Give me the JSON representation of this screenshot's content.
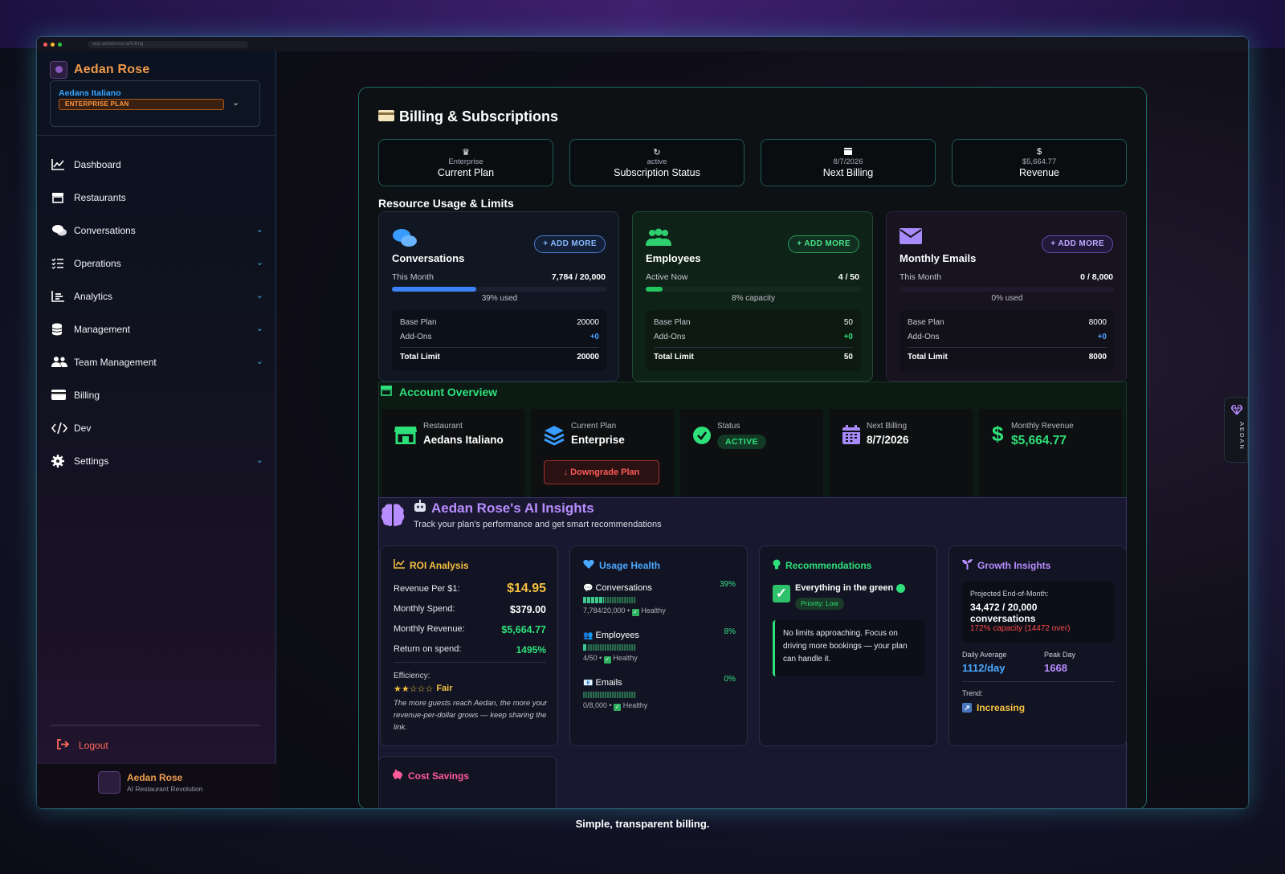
{
  "browser": {
    "url": "app.aedanrose.ai/billing"
  },
  "brand": {
    "name": "Aedan Rose",
    "tagline": "AI Restaurant Revolution"
  },
  "account": {
    "name": "Aedans Italiano",
    "plan_badge": "ENTERPRISE PLAN"
  },
  "sidebar": {
    "items": [
      {
        "label": "Dashboard",
        "icon": "chart-line-icon",
        "expandable": false
      },
      {
        "label": "Restaurants",
        "icon": "store-icon",
        "expandable": false
      },
      {
        "label": "Conversations",
        "icon": "chat-icon",
        "expandable": true
      },
      {
        "label": "Operations",
        "icon": "list-check-icon",
        "expandable": true
      },
      {
        "label": "Analytics",
        "icon": "bar-chart-icon",
        "expandable": true
      },
      {
        "label": "Management",
        "icon": "database-icon",
        "expandable": true
      },
      {
        "label": "Team Management",
        "icon": "users-icon",
        "expandable": true
      },
      {
        "label": "Billing",
        "icon": "credit-card-icon",
        "expandable": false
      },
      {
        "label": "Dev",
        "icon": "code-icon",
        "expandable": false
      },
      {
        "label": "Settings",
        "icon": "gear-icon",
        "expandable": true
      }
    ],
    "logout": "Logout"
  },
  "page": {
    "title": "Billing & Subscriptions"
  },
  "stats": [
    {
      "icon": "crown-icon",
      "value": "Enterprise",
      "label": "Current Plan"
    },
    {
      "icon": "refresh-icon",
      "value": "active",
      "label": "Subscription Status"
    },
    {
      "icon": "calendar-icon",
      "value": "8/7/2026",
      "label": "Next Billing"
    },
    {
      "icon": "dollar-icon",
      "value": "$5,664.77",
      "label": "Revenue"
    }
  ],
  "resources": {
    "heading": "Resource Usage & Limits",
    "add_more": "+ ADD MORE",
    "labels": {
      "base": "Base Plan",
      "addons": "Add-Ons",
      "total": "Total Limit"
    },
    "cards": [
      {
        "title": "Conversations",
        "period": "This Month",
        "usage": "7,784 / 20,000",
        "fraction": 0.39,
        "pct_text": "39% used",
        "base": "20000",
        "addons": "+0",
        "total": "20000",
        "color": "#3b82f6"
      },
      {
        "title": "Employees",
        "period": "Active Now",
        "usage": "4 / 50",
        "fraction": 0.08,
        "pct_text": "8% capacity",
        "base": "50",
        "addons": "+0",
        "total": "50",
        "color": "#22c55e"
      },
      {
        "title": "Monthly Emails",
        "period": "This Month",
        "usage": "0 / 8,000",
        "fraction": 0.0,
        "pct_text": "0% used",
        "base": "8000",
        "addons": "+0",
        "total": "8000",
        "color": "#a78bfa"
      }
    ]
  },
  "overview": {
    "title": "Account Overview",
    "restaurant": {
      "label": "Restaurant",
      "value": "Aedans Italiano"
    },
    "plan": {
      "label": "Current Plan",
      "value": "Enterprise",
      "downgrade": "↓ Downgrade Plan"
    },
    "status": {
      "label": "Status",
      "value": "ACTIVE"
    },
    "next_billing": {
      "label": "Next Billing",
      "value": "8/7/2026"
    },
    "monthly_revenue": {
      "label": "Monthly Revenue",
      "value": "$5,664.77"
    }
  },
  "insights": {
    "title": "Aedan Rose's AI Insights",
    "subtitle": "Track your plan's performance and get smart recommendations",
    "roi": {
      "title": "ROI Analysis",
      "rows": [
        {
          "label": "Revenue Per $1:",
          "value": "$14.95"
        },
        {
          "label": "Monthly Spend:",
          "value": "$379.00"
        },
        {
          "label": "Monthly Revenue:",
          "value": "$5,664.77"
        },
        {
          "label": "Return on spend:",
          "value": "1495%"
        }
      ],
      "efficiency_label": "Efficiency:",
      "stars": "★★☆☆☆",
      "rating": "Fair",
      "note": "The more guests reach Aedan, the more your revenue-per-dollar grows — keep sharing the link."
    },
    "usage_health": {
      "title": "Usage Health",
      "items": [
        {
          "label": "Conversations",
          "pct": "39%",
          "fraction": 0.39,
          "detail": "7,784/20,000 •",
          "status": "Healthy"
        },
        {
          "label": "Employees",
          "pct": "8%",
          "fraction": 0.08,
          "detail": "4/50 •",
          "status": "Healthy"
        },
        {
          "label": "Emails",
          "pct": "0%",
          "fraction": 0.0,
          "detail": "0/8,000 •",
          "status": "Healthy"
        }
      ]
    },
    "recommendations": {
      "title": "Recommendations",
      "headline": "Everything in the green",
      "priority": "Priority: Low",
      "body": "No limits approaching. Focus on driving more bookings — your plan can handle it."
    },
    "growth": {
      "title": "Growth Insights",
      "projected_label": "Projected End-of-Month:",
      "projected_value": "34,472 / 20,000",
      "projected_unit": "conversations",
      "capacity": "172% capacity (14472 over)",
      "daily_label": "Daily Average",
      "daily_value": "1112/day",
      "peak_label": "Peak Day",
      "peak_value": "1668",
      "trend_label": "Trend:",
      "trend_value": "Increasing"
    },
    "cost_savings": {
      "title": "Cost Savings"
    }
  },
  "rail": {
    "label": "AEDAN"
  },
  "caption": "Simple, transparent billing.",
  "colors": {
    "accent_orange": "#f09a4a",
    "accent_teal": "#1e6b66",
    "green": "#2ee07a",
    "purple": "#b88dff",
    "blue": "#3aa5ff"
  }
}
